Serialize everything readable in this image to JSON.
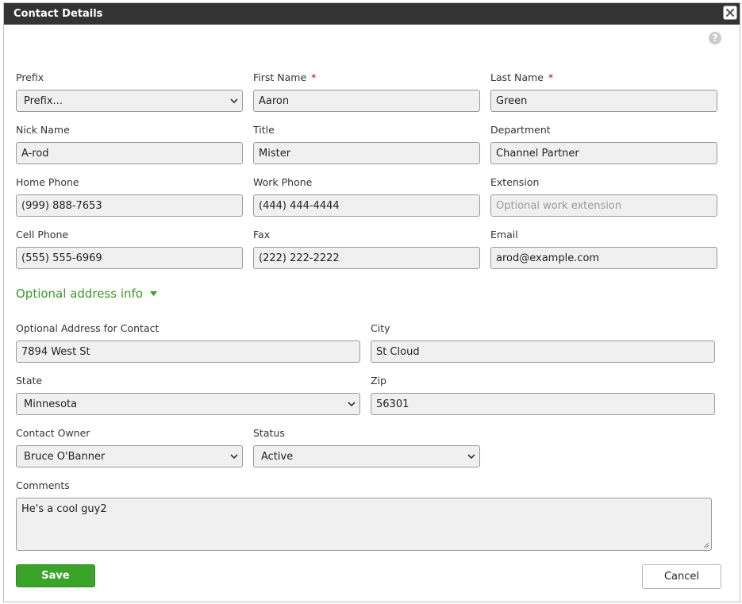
{
  "dialog": {
    "title": "Contact Details",
    "close_icon": "close-icon",
    "help_icon": "help-icon",
    "help_glyph": "?"
  },
  "form": {
    "required_marker": "*",
    "prefix": {
      "label": "Prefix",
      "value": "Prefix..."
    },
    "first_name": {
      "label": "First Name",
      "value": "Aaron",
      "required": true
    },
    "last_name": {
      "label": "Last Name",
      "value": "Green",
      "required": true
    },
    "nick_name": {
      "label": "Nick Name",
      "value": "A-rod"
    },
    "title": {
      "label": "Title",
      "value": "Mister"
    },
    "department": {
      "label": "Department",
      "value": "Channel Partner"
    },
    "home_phone": {
      "label": "Home Phone",
      "value": "(999) 888-7653"
    },
    "work_phone": {
      "label": "Work Phone",
      "value": "(444) 444-4444"
    },
    "extension": {
      "label": "Extension",
      "value": "",
      "placeholder": "Optional work extension"
    },
    "cell_phone": {
      "label": "Cell Phone",
      "value": "(555) 555-6969"
    },
    "fax": {
      "label": "Fax",
      "value": "(222) 222-2222"
    },
    "email": {
      "label": "Email",
      "value": "arod@example.com"
    }
  },
  "address_section": {
    "toggle_label": "Optional address info",
    "expanded": true,
    "address": {
      "label": "Optional Address for Contact",
      "value": "7894 West St"
    },
    "city": {
      "label": "City",
      "value": "St Cloud"
    },
    "state": {
      "label": "State",
      "value": "Minnesota"
    },
    "zip": {
      "label": "Zip",
      "value": "56301"
    }
  },
  "owner": {
    "label": "Contact Owner",
    "value": "Bruce O'Banner"
  },
  "status": {
    "label": "Status",
    "value": "Active"
  },
  "comments": {
    "label": "Comments",
    "value": "He's a cool guy2"
  },
  "actions": {
    "save_label": "Save",
    "cancel_label": "Cancel"
  },
  "colors": {
    "titlebar": "#333333",
    "accent_green": "#3ba32a",
    "link_green": "#3a9a2a",
    "required_red": "#cc0000",
    "field_bg": "#f0f0f0"
  }
}
